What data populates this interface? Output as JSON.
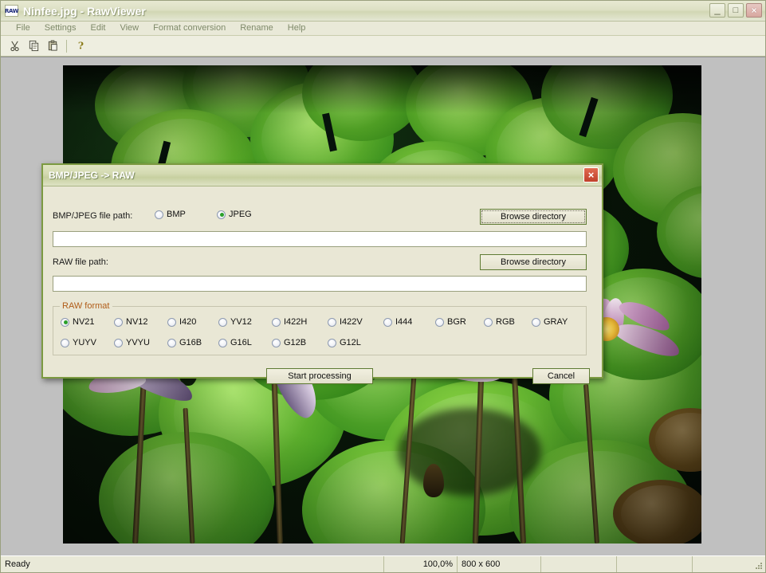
{
  "window": {
    "icon": "raw-app-icon",
    "icon_text": "RAW",
    "title": "Ninfee.jpg - RawViewer",
    "buttons": {
      "minimize": "_",
      "maximize": "□",
      "close": "×"
    }
  },
  "menubar": {
    "items": [
      {
        "label": "File"
      },
      {
        "label": "Settings"
      },
      {
        "label": "Edit"
      },
      {
        "label": "View"
      },
      {
        "label": "Format conversion"
      },
      {
        "label": "Rename"
      },
      {
        "label": "Help"
      }
    ]
  },
  "toolbar": {
    "items": [
      {
        "name": "cut-icon",
        "glyph": "✂"
      },
      {
        "name": "copy-icon",
        "glyph": "❐"
      },
      {
        "name": "paste-icon",
        "glyph": "📋"
      },
      {
        "name": "help-icon",
        "glyph": "?"
      }
    ]
  },
  "photo": {
    "alt": "water lilies on a pond with large green lily pads",
    "background": "#06110a"
  },
  "dialog": {
    "title": "BMP/JPEG -> RAW",
    "close_label": "×",
    "source": {
      "label": "BMP/JPEG file path:",
      "options": [
        {
          "label": "BMP",
          "selected": false
        },
        {
          "label": "JPEG",
          "selected": true
        }
      ],
      "browse_label": "Browse directory",
      "path_value": "",
      "path_placeholder": ""
    },
    "destination": {
      "label": "RAW file path:",
      "browse_label": "Browse directory",
      "path_value": "",
      "path_placeholder": ""
    },
    "raw_format": {
      "group_label": "RAW format",
      "row1": [
        {
          "label": "NV21",
          "selected": true
        },
        {
          "label": "NV12",
          "selected": false
        },
        {
          "label": "I420",
          "selected": false
        },
        {
          "label": "YV12",
          "selected": false
        },
        {
          "label": "I422H",
          "selected": false
        },
        {
          "label": "I422V",
          "selected": false
        },
        {
          "label": "I444",
          "selected": false
        },
        {
          "label": "BGR",
          "selected": false
        },
        {
          "label": "RGB",
          "selected": false
        },
        {
          "label": "GRAY",
          "selected": false
        }
      ],
      "row2": [
        {
          "label": "YUYV",
          "selected": false
        },
        {
          "label": "YVYU",
          "selected": false
        },
        {
          "label": "G16B",
          "selected": false
        },
        {
          "label": "G16L",
          "selected": false
        },
        {
          "label": "G12B",
          "selected": false
        },
        {
          "label": "G12L",
          "selected": false
        }
      ]
    },
    "actions": {
      "start_label": "Start processing",
      "cancel_label": "Cancel"
    }
  },
  "statusbar": {
    "message": "Ready",
    "zoom": "100,0%",
    "dimensions": "800 x 600",
    "cell4": "",
    "cell5": "",
    "cell6": ""
  },
  "colors": {
    "chrome": "#e9e9d8",
    "dialog_border": "#7c9a41",
    "group_label": "#b05c18",
    "radio_dot": "#2aa02a",
    "canvas": "#c0c0c0"
  }
}
